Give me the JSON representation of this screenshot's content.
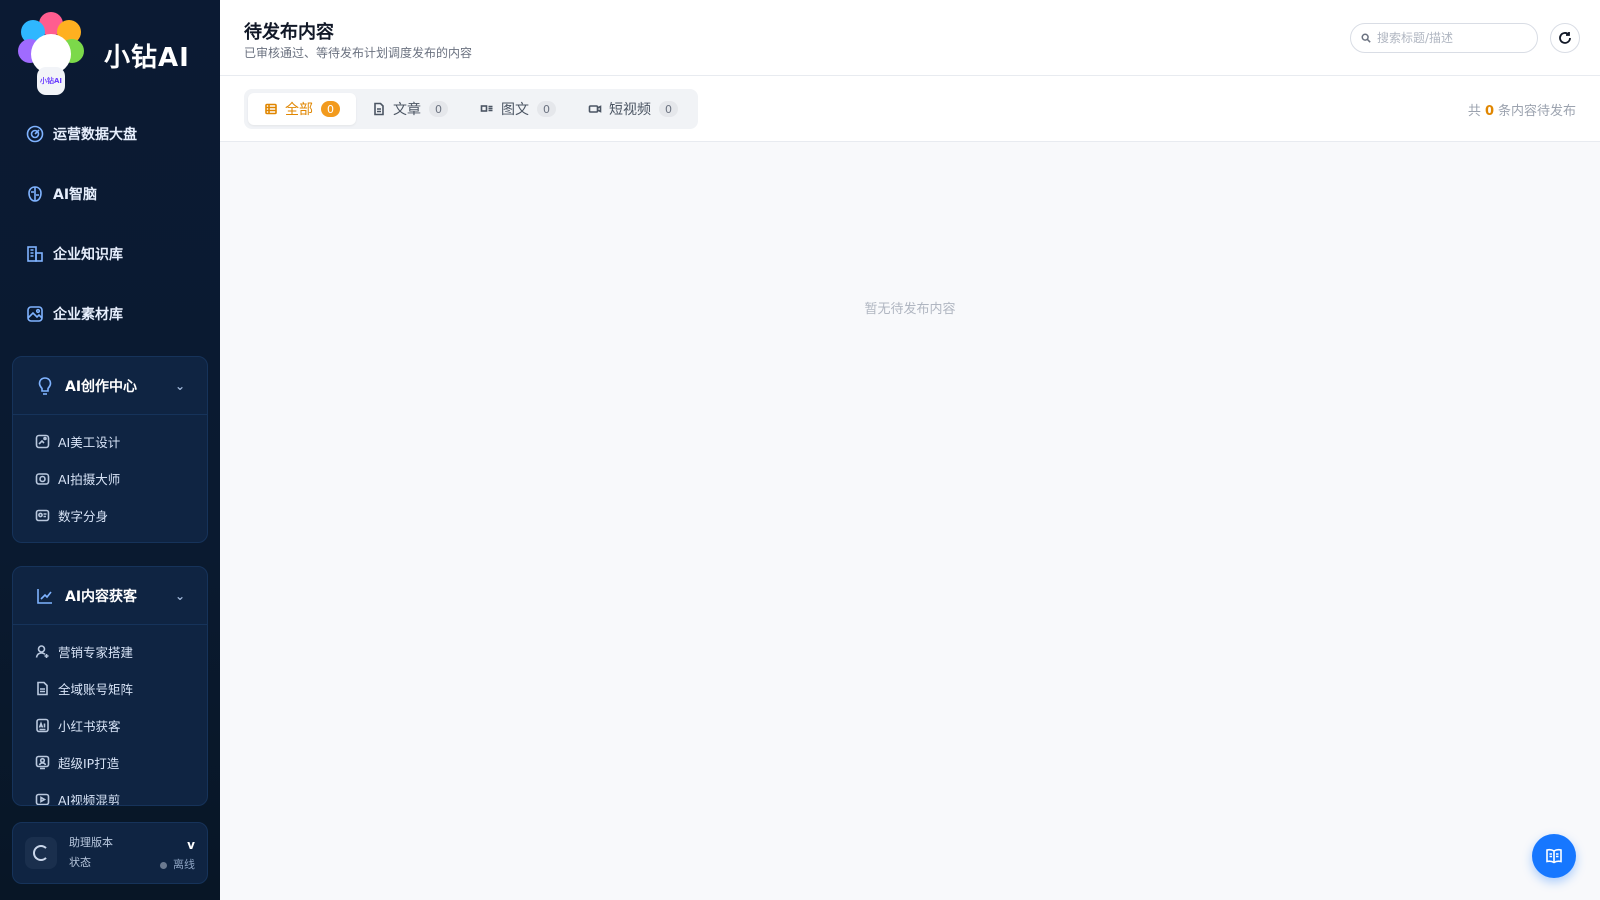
{
  "brand": {
    "name": "小钻AI",
    "logo_text": "小钻AI"
  },
  "nav": [
    {
      "label": "运营数据大盘",
      "icon": "dashboard-icon"
    },
    {
      "label": "AI智脑",
      "icon": "brain-icon"
    },
    {
      "label": "企业知识库",
      "icon": "building-icon"
    },
    {
      "label": "企业素材库",
      "icon": "image-icon"
    }
  ],
  "groups": [
    {
      "title": "AI创作中心",
      "icon": "bulb-icon",
      "items": [
        {
          "label": "AI美工设计",
          "icon": "design-icon"
        },
        {
          "label": "AI拍摄大师",
          "icon": "camera-icon"
        },
        {
          "label": "数字分身",
          "icon": "avatar-card-icon"
        }
      ]
    },
    {
      "title": "AI内容获客",
      "icon": "chart-icon",
      "items": [
        {
          "label": "营销专家搭建",
          "icon": "user-add-icon"
        },
        {
          "label": "全域账号矩阵",
          "icon": "file-icon"
        },
        {
          "label": "小红书获客",
          "icon": "ai-box-icon"
        },
        {
          "label": "超级IP打造",
          "icon": "ip-icon"
        },
        {
          "label": "AI视频混剪",
          "icon": "video-icon"
        }
      ]
    }
  ],
  "status": {
    "version_label": "助理版本",
    "version_value": "v",
    "state_label": "状态",
    "state_value": "离线"
  },
  "header": {
    "title": "待发布内容",
    "subtitle": "已审核通过、等待发布计划调度发布的内容"
  },
  "search": {
    "placeholder": "搜索标题/描述"
  },
  "tabs": [
    {
      "label": "全部",
      "count": "0",
      "active": true
    },
    {
      "label": "文章",
      "count": "0"
    },
    {
      "label": "图文",
      "count": "0"
    },
    {
      "label": "短视频",
      "count": "0"
    }
  ],
  "total": {
    "prefix": "共",
    "count": "0",
    "suffix": "条内容待发布"
  },
  "empty_text": "暂无待发布内容",
  "colors": {
    "accent": "#e08600",
    "primary": "#1677ff",
    "sidebar_bg": "#0b1a33"
  }
}
